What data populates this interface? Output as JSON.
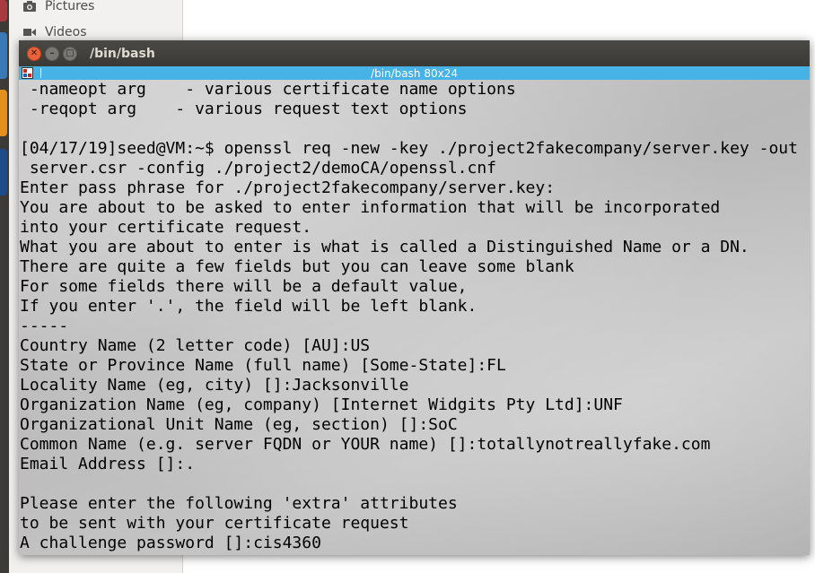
{
  "desktop": {
    "files_sidebar": [
      {
        "label": "Pictures",
        "icon": "camera-icon"
      },
      {
        "label": "Videos",
        "icon": "video-icon"
      }
    ]
  },
  "terminal": {
    "window_title": "/bin/bash",
    "menubar_title": "/bin/bash 80x24",
    "lines": [
      " -nameopt arg    - various certificate name options",
      " -reqopt arg    - various request text options",
      "",
      "[04/17/19]seed@VM:~$ openssl req -new -key ./project2fakecompany/server.key -out",
      " server.csr -config ./project2/demoCA/openssl.cnf",
      "Enter pass phrase for ./project2fakecompany/server.key:",
      "You are about to be asked to enter information that will be incorporated",
      "into your certificate request.",
      "What you are about to enter is what is called a Distinguished Name or a DN.",
      "There are quite a few fields but you can leave some blank",
      "For some fields there will be a default value,",
      "If you enter '.', the field will be left blank.",
      "-----",
      "Country Name (2 letter code) [AU]:US",
      "State or Province Name (full name) [Some-State]:FL",
      "Locality Name (eg, city) []:Jacksonville",
      "Organization Name (eg, company) [Internet Widgits Pty Ltd]:UNF",
      "Organizational Unit Name (eg, section) []:SoC",
      "Common Name (e.g. server FQDN or YOUR name) []:totallynotreallyfake.com",
      "Email Address []:.",
      "",
      "Please enter the following 'extra' attributes",
      "to be sent with your certificate request",
      "A challenge password []:cis4360"
    ]
  }
}
